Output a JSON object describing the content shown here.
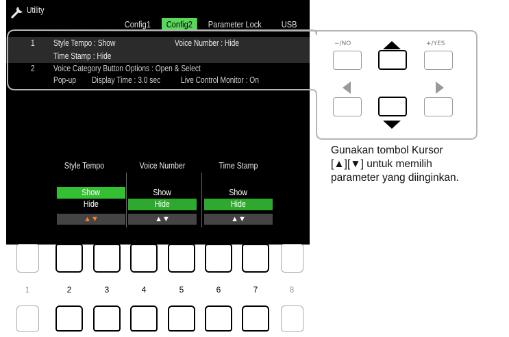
{
  "screen": {
    "title": "Utility",
    "tabs": [
      {
        "label": "Config1",
        "active": false
      },
      {
        "label": "Config2",
        "active": true
      },
      {
        "label": "Parameter Lock",
        "active": false
      },
      {
        "label": "USB",
        "active": false
      }
    ],
    "rows": {
      "r1_num": "1",
      "r1_style_tempo": "Style Tempo : Show",
      "r1_voice_number": "Voice Number : Hide",
      "r1_time_stamp": "Time Stamp : Hide",
      "r2_num": "2",
      "r2_voice_category": "Voice Category Button Options : Open & Select",
      "r2_popup": "Pop-up",
      "r2_display_time": "Display Time : 3.0 sec",
      "r2_live_control": "Live Control Monitor : On"
    },
    "columns": [
      {
        "header": "Style Tempo",
        "options": [
          "Show",
          "Hide"
        ],
        "selected": "Show",
        "arrows": "▲▼"
      },
      {
        "header": "Voice Number",
        "options": [
          "Show",
          "Hide"
        ],
        "selected": "Hide",
        "arrows": "▲▼"
      },
      {
        "header": "Time Stamp",
        "options": [
          "Show",
          "Hide"
        ],
        "selected": "Hide",
        "arrows": "▲▼"
      }
    ],
    "colors": {
      "accent_green": "#33c033",
      "highlight_orange": "#ff7f1e"
    }
  },
  "cursor_buttons": {
    "no_label": "−/NO",
    "yes_label": "+/YES"
  },
  "instruction": {
    "line1": "Gunakan tombol Kursor",
    "line2": "[▲][▼] untuk memilih",
    "line3": "parameter yang diinginkan."
  },
  "bottom_buttons": {
    "numbers": [
      "1",
      "2",
      "3",
      "4",
      "5",
      "6",
      "7",
      "8"
    ]
  }
}
